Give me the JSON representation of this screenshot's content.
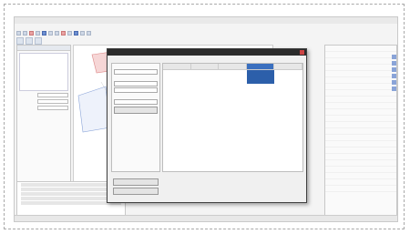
{
  "app": {
    "title": ""
  },
  "menubar": {
    "items": [
      "",
      "",
      "",
      "",
      "",
      "",
      ""
    ]
  },
  "tabs": [
    "",
    "",
    ""
  ],
  "leftpanel": {
    "title": "",
    "tree": [
      "",
      "",
      "",
      "",
      ""
    ],
    "fields": [
      "",
      "",
      ""
    ]
  },
  "dialog": {
    "title": "",
    "left_labels": [
      "",
      "",
      ""
    ],
    "buttons": [
      "",
      "",
      ""
    ],
    "table_headers": [
      "",
      "",
      "",
      "",
      ""
    ],
    "rows": [
      [
        "",
        "",
        "",
        "",
        ""
      ],
      [
        "",
        "",
        "",
        "",
        ""
      ],
      [
        "",
        "",
        "",
        "",
        ""
      ]
    ]
  },
  "rightpanel": {
    "rows": [
      "",
      "",
      "",
      "",
      "",
      "",
      "",
      "",
      "",
      "",
      "",
      "",
      "",
      "",
      "",
      "",
      "",
      "",
      "",
      "",
      "",
      "",
      ""
    ]
  },
  "statusbar": {
    "items": [
      "",
      ""
    ]
  },
  "colors": {
    "selection": "#2c5faa",
    "dialog_title": "#2b2b2b",
    "panel_accent": "#8aa4d8"
  }
}
